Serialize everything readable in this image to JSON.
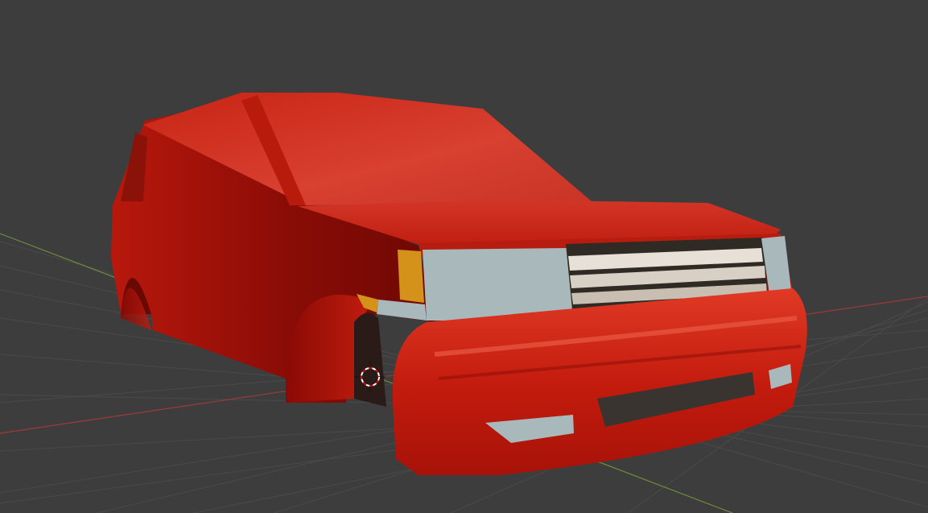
{
  "viewport": {
    "name": "3D Viewport",
    "background_color": "#3d3d3d",
    "grid_color": "#4a4a4a",
    "x_axis_color": "#a03a3a",
    "y_axis_color": "#6e8a3a"
  },
  "scene": {
    "object": "car-body",
    "body_color": "#d42a1a",
    "grille_color": "#2f2a24",
    "headlight_color": "#a8b8bb",
    "indicator_color": "#d4921a"
  },
  "cursor": {
    "icon": "3d-cursor-icon"
  }
}
